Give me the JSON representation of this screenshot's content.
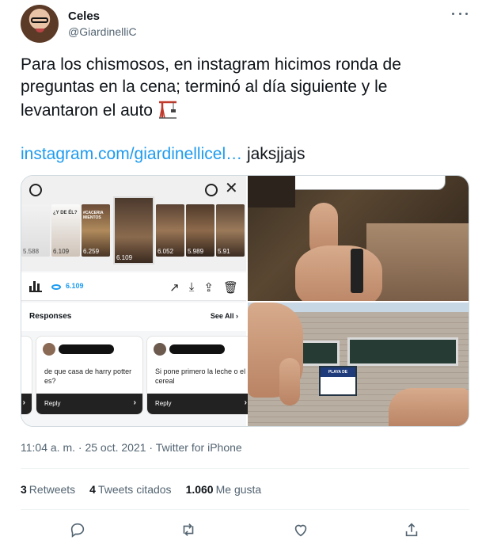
{
  "author": {
    "name": "Celes",
    "handle": "@GiardinelliC"
  },
  "tweet": {
    "text": "Para los chismosos, en instagram hicimos ronda de preguntas en la cena; terminó al día siguiente y le levantaron el auto",
    "emoji_icon": "construction-crane-icon",
    "link_text": "instagram.com/giardinellicel…",
    "link_suffix": " jaksjjajs"
  },
  "media": {
    "instagram_screenshot": {
      "views_count": "6.109",
      "thumb_counts": [
        "5.588",
        "6.109",
        "6.259",
        "6.109",
        "6.052",
        "5.989",
        "5.91"
      ],
      "thumb_label_1": "¿Y DE ÉL?",
      "thumb_label_2": "#CACERIA\nMIENTOS",
      "responses_title": "Responses",
      "see_all": "See All",
      "responses": [
        {
          "question": "de que casa de harry potter es?",
          "reply_label": "Reply"
        },
        {
          "question": "Si pone primero la leche o el cereal",
          "reply_label": "Reply"
        }
      ]
    },
    "sign_text": "PLAYA DE ACARREO"
  },
  "meta": {
    "time": "11:04 a. m.",
    "separator": " · ",
    "date": "25 oct. 2021",
    "source": "Twitter for iPhone"
  },
  "stats": {
    "retweets_count": "3",
    "retweets_label": "Retweets",
    "quotes_count": "4",
    "quotes_label": "Tweets citados",
    "likes_count": "1.060",
    "likes_label": "Me gusta"
  },
  "icons": {
    "reply": "reply-icon",
    "retweet": "retweet-icon",
    "like": "like-icon",
    "share": "share-icon",
    "more": "more-icon"
  },
  "colors": {
    "link": "#1d9bf0",
    "secondary_text": "#536471",
    "primary_text": "#0f1419"
  }
}
